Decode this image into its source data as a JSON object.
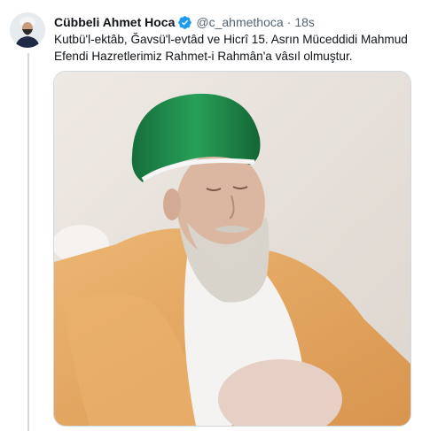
{
  "author": {
    "display_name": "Cübbeli Ahmet Hoca",
    "handle": "@c_ahmethoca",
    "separator": "·",
    "time": "18s",
    "verified_color": "#1d9bf0"
  },
  "tweet": {
    "text": "Kutbü'l-ektâb, Ğavsü'l-evtâd ve Hicrî 15. Asrın Müceddidi Mahmud Efendi Hazretlerimiz Rahmet-i Rahmân'a vâsıl olmuştur."
  },
  "media": {
    "icon": "photo",
    "colors": {
      "background": "#e8e2dc",
      "turban": "#1f8a4c",
      "robe": "#e3a866",
      "beard": "#d9d4cc",
      "skin": "#d9b5a0"
    }
  },
  "icons": {
    "avatar": "avatar-photo",
    "verified": "verified-badge-icon"
  }
}
